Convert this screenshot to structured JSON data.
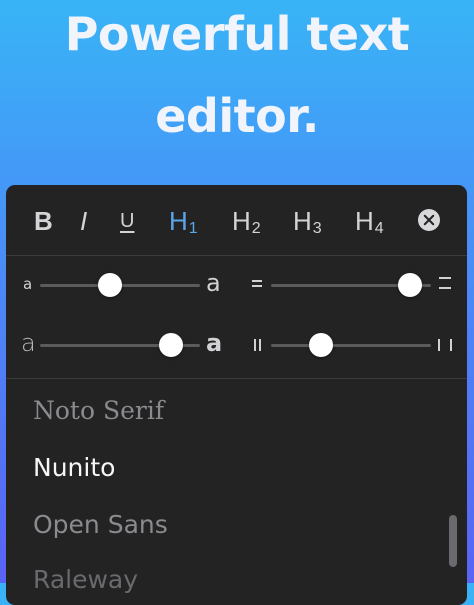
{
  "headline": {
    "line1": "Powerful text",
    "line2": "editor."
  },
  "toolbar": {
    "bold": "B",
    "italic": "I",
    "underline": "U",
    "h1_letter": "H",
    "h1_num": "1",
    "h2_letter": "H",
    "h2_num": "2",
    "h3_letter": "H",
    "h3_num": "3",
    "h4_letter": "H",
    "h4_num": "4",
    "active": "H1",
    "active_color": "#5aa6ea"
  },
  "sliders": {
    "font_size": {
      "min_label": "a",
      "max_label": "a",
      "value": 0.44
    },
    "line_height": {
      "value": 0.87
    },
    "font_weight": {
      "min_label": "a",
      "max_label": "a",
      "value": 0.82
    },
    "letter_spacing": {
      "value": 0.31
    }
  },
  "fonts": {
    "items": [
      "Noto Serif",
      "Nunito",
      "Open Sans",
      "Raleway"
    ],
    "selected": "Nunito"
  },
  "colors": {
    "background_top": "#38b4f6",
    "background_bottom": "#5a63f5",
    "panel": "#232324"
  }
}
